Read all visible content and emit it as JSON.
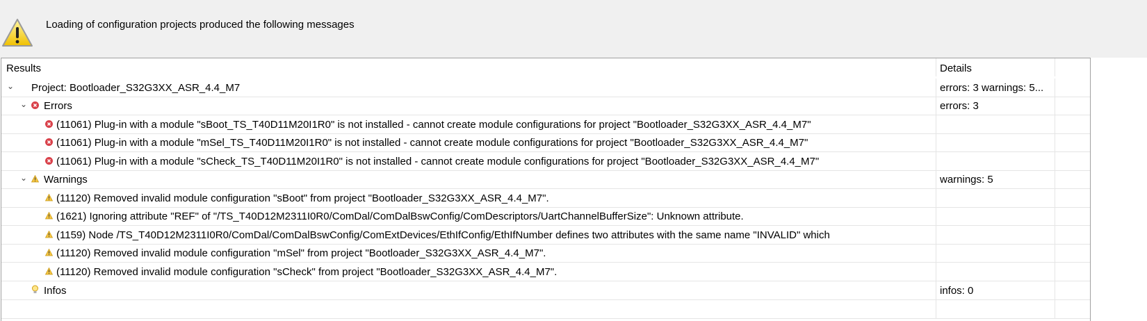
{
  "dialog": {
    "message": "Loading of configuration projects produced the following messages"
  },
  "table": {
    "headers": {
      "results": "Results",
      "details": "Details"
    },
    "project": {
      "label": "Project: Bootloader_S32G3XX_ASR_4.4_M7",
      "details": "errors: 3 warnings: 5..."
    },
    "errors": {
      "label": "Errors",
      "details": "errors: 3",
      "items": [
        "(11061) Plug-in with a module \"sBoot_TS_T40D11M20I1R0\" is not installed - cannot create module configurations for project \"Bootloader_S32G3XX_ASR_4.4_M7\"",
        "(11061) Plug-in with a module \"mSel_TS_T40D11M20I1R0\" is not installed - cannot create module configurations for project \"Bootloader_S32G3XX_ASR_4.4_M7\"",
        "(11061) Plug-in with a module \"sCheck_TS_T40D11M20I1R0\" is not installed - cannot create module configurations for project \"Bootloader_S32G3XX_ASR_4.4_M7\""
      ]
    },
    "warnings": {
      "label": "Warnings",
      "details": "warnings: 5",
      "items": [
        "(11120) Removed invalid module configuration \"sBoot\" from project \"Bootloader_S32G3XX_ASR_4.4_M7\".",
        "(1621) Ignoring attribute \"REF\" of \"/TS_T40D12M2311I0R0/ComDal/ComDalBswConfig/ComDescriptors/UartChannelBufferSize\": Unknown attribute.",
        "(1159) Node /TS_T40D12M2311I0R0/ComDal/ComDalBswConfig/ComExtDevices/EthIfConfig/EthIfNumber defines two attributes with the same name \"INVALID\" which",
        "(11120) Removed invalid module configuration \"mSel\" from project \"Bootloader_S32G3XX_ASR_4.4_M7\".",
        "(11120) Removed invalid module configuration \"sCheck\" from project \"Bootloader_S32G3XX_ASR_4.4_M7\"."
      ]
    },
    "infos": {
      "label": "Infos",
      "details": "infos: 0"
    }
  }
}
